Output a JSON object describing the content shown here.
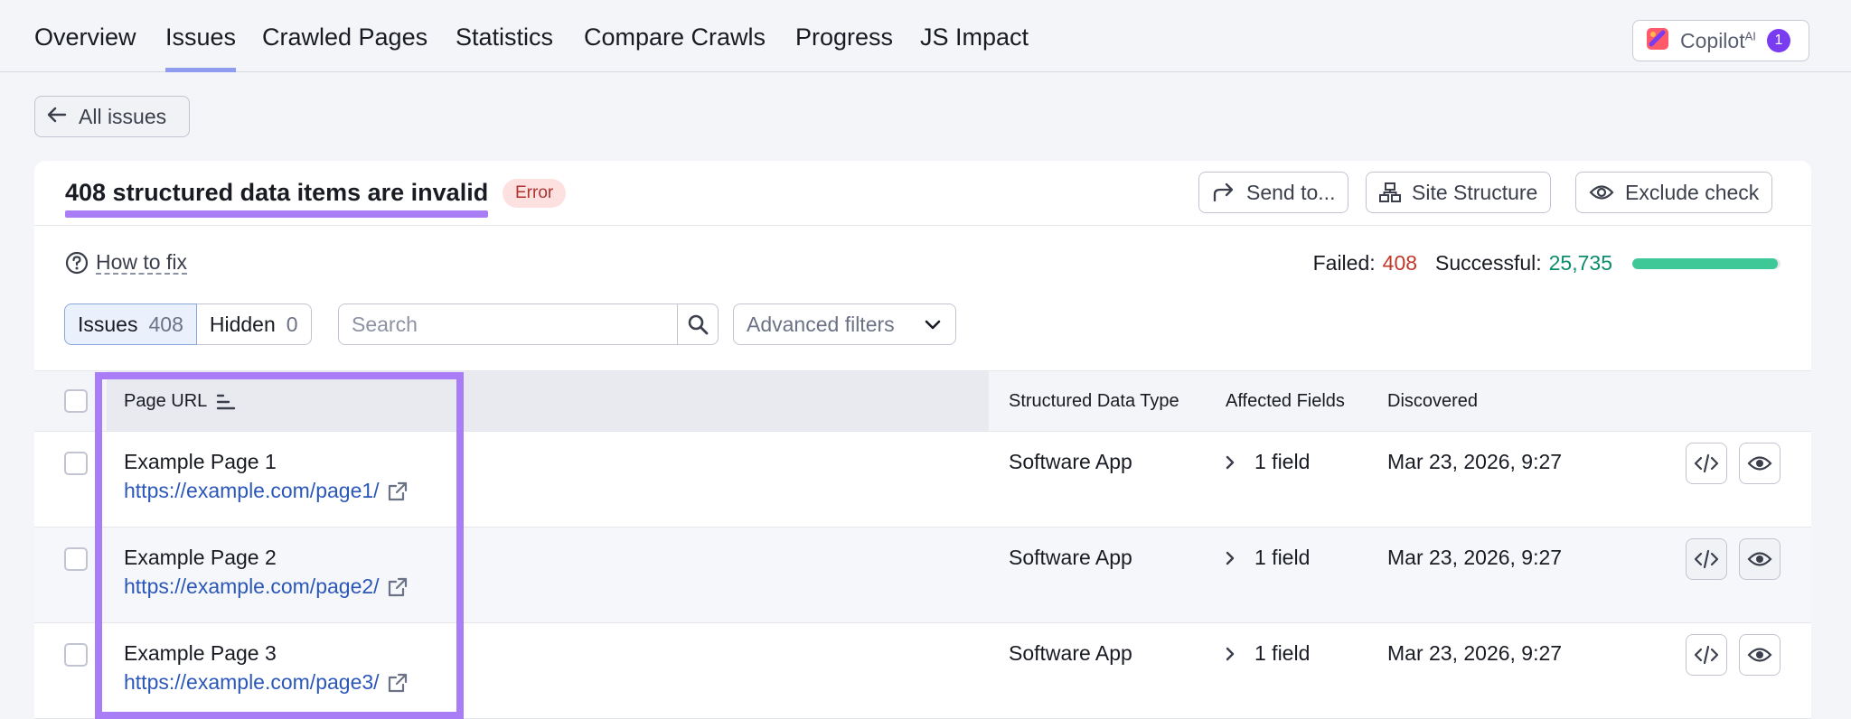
{
  "nav": {
    "tabs": [
      {
        "label": "Overview"
      },
      {
        "label": "Issues"
      },
      {
        "label": "Crawled Pages"
      },
      {
        "label": "Statistics"
      },
      {
        "label": "Compare Crawls"
      },
      {
        "label": "Progress"
      },
      {
        "label": "JS Impact"
      }
    ],
    "active_tab": "Issues",
    "copilot": {
      "label": "Copilot",
      "sup": "AI",
      "badge": "1"
    }
  },
  "back_button": {
    "label": "All issues"
  },
  "issue": {
    "title": "408 structured data items are invalid",
    "severity": "Error",
    "actions": {
      "send_to": "Send to...",
      "site_structure": "Site Structure",
      "exclude_check": "Exclude check"
    },
    "how_to_fix": "How to fix",
    "failed_label": "Failed:",
    "failed_value": "408",
    "successful_label": "Successful:",
    "successful_value": "25,735",
    "success_ratio": 0.984
  },
  "filters": {
    "issues_label": "Issues",
    "issues_count": "408",
    "hidden_label": "Hidden",
    "hidden_count": "0",
    "search_placeholder": "Search",
    "advanced_label": "Advanced filters"
  },
  "table": {
    "headers": {
      "url": "Page URL",
      "type": "Structured Data Type",
      "fields": "Affected Fields",
      "discovered": "Discovered"
    },
    "rows": [
      {
        "name": "Example Page 1",
        "url": "https://example.com/page1/",
        "type": "Software App",
        "fields": "1 field",
        "discovered": "Mar 23, 2026, 9:27"
      },
      {
        "name": "Example Page 2",
        "url": "https://example.com/page2/",
        "type": "Software App",
        "fields": "1 field",
        "discovered": "Mar 23, 2026, 9:27"
      },
      {
        "name": "Example Page 3",
        "url": "https://example.com/page3/",
        "type": "Software App",
        "fields": "1 field",
        "discovered": "Mar 23, 2026, 9:27"
      }
    ]
  },
  "colors": {
    "accent": "#8f9cf0",
    "highlight": "#a97df5",
    "error": "#c0392b",
    "success": "#3ec897",
    "link": "#2a57b8"
  }
}
